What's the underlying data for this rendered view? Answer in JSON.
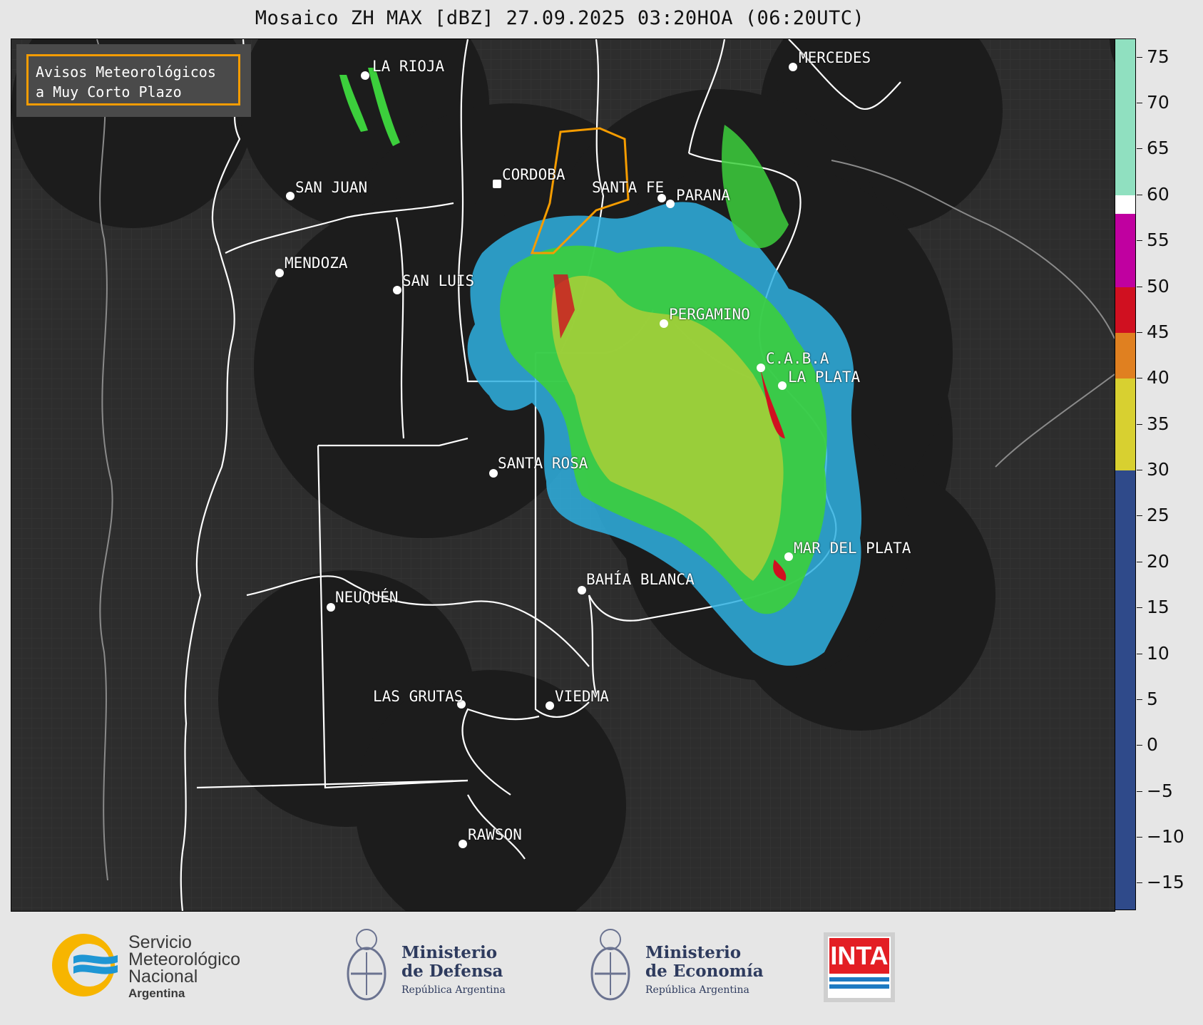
{
  "title": "Mosaico ZH MAX [dBZ] 27.09.2025 03:20HOA (06:20UTC)",
  "notice": {
    "line1": "Avisos Meteorológicos",
    "line2": "a Muy Corto Plazo",
    "border_color": "#f59c00"
  },
  "cities": [
    {
      "name": "LA RIOJA"
    },
    {
      "name": "MERCEDES"
    },
    {
      "name": "CORDOBA"
    },
    {
      "name": "SAN JUAN"
    },
    {
      "name": "SANTA FE"
    },
    {
      "name": "PARANA"
    },
    {
      "name": "MENDOZA"
    },
    {
      "name": "SAN LUIS"
    },
    {
      "name": "PERGAMINO"
    },
    {
      "name": "C.A.B.A"
    },
    {
      "name": "LA PLATA"
    },
    {
      "name": "SANTA ROSA"
    },
    {
      "name": "MAR DEL PLATA"
    },
    {
      "name": "BAHÍA BLANCA"
    },
    {
      "name": "NEUQUÉN"
    },
    {
      "name": "LAS GRUTAS"
    },
    {
      "name": "VIEDMA"
    },
    {
      "name": "RAWSON"
    }
  ],
  "colorbar": {
    "ticks": [
      "75",
      "70",
      "65",
      "60",
      "55",
      "50",
      "45",
      "40",
      "35",
      "30",
      "25",
      "20",
      "15",
      "10",
      "5",
      "0",
      "−5",
      "−10",
      "−15"
    ],
    "min": -18,
    "max": 77,
    "colors": [
      {
        "from": -18,
        "to": 30,
        "color": "#2f4a8a"
      },
      {
        "from": 30,
        "to": 40,
        "color": "#d8d030"
      },
      {
        "from": 40,
        "to": 45,
        "color": "#e08020"
      },
      {
        "from": 45,
        "to": 50,
        "color": "#d01020"
      },
      {
        "from": 50,
        "to": 58,
        "color": "#c000a0"
      },
      {
        "from": 58,
        "to": 60,
        "color": "#ffffff"
      },
      {
        "from": 60,
        "to": 77,
        "color": "#90e0c0"
      }
    ]
  },
  "footer": {
    "smn_line1": "Servicio",
    "smn_line2": "Meteorológico",
    "smn_line3": "Nacional",
    "smn_line4": "Argentina",
    "defensa_line1": "Ministerio",
    "defensa_line2": "de Defensa",
    "defensa_line3": "República Argentina",
    "economia_line1": "Ministerio",
    "economia_line2": "de Economía",
    "economia_line3": "República Argentina",
    "inta": "INTA"
  }
}
